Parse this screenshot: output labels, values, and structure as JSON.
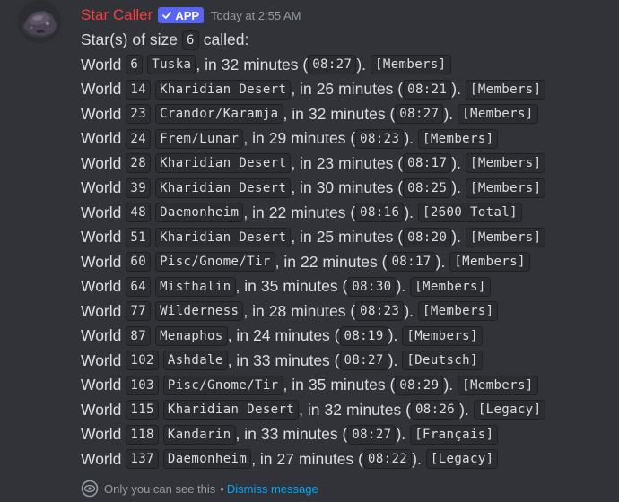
{
  "message": {
    "author": "Star Caller",
    "badge": "APP",
    "timestamp": "Today at 2:55 AM",
    "intro": {
      "prefix": "Star(s) of size",
      "size": "6",
      "suffix": "called:"
    },
    "world_label": "World",
    "in_label": ", in",
    "minutes_label": "minutes (",
    "close_label": ").",
    "rows": [
      {
        "world": "6",
        "location": "Tuska",
        "minutes": "32",
        "time": "08:27",
        "tag": "[Members]"
      },
      {
        "world": "14",
        "location": "Kharidian Desert",
        "minutes": "26",
        "time": "08:21",
        "tag": "[Members]"
      },
      {
        "world": "23",
        "location": "Crandor/Karamja",
        "minutes": "32",
        "time": "08:27",
        "tag": "[Members]"
      },
      {
        "world": "24",
        "location": "Frem/Lunar",
        "minutes": "29",
        "time": "08:23",
        "tag": "[Members]"
      },
      {
        "world": "28",
        "location": "Kharidian Desert",
        "minutes": "23",
        "time": "08:17",
        "tag": "[Members]"
      },
      {
        "world": "39",
        "location": "Kharidian Desert",
        "minutes": "30",
        "time": "08:25",
        "tag": "[Members]"
      },
      {
        "world": "48",
        "location": "Daemonheim",
        "minutes": "22",
        "time": "08:16",
        "tag": "[2600 Total]"
      },
      {
        "world": "51",
        "location": "Kharidian Desert",
        "minutes": "25",
        "time": "08:20",
        "tag": "[Members]"
      },
      {
        "world": "60",
        "location": "Pisc/Gnome/Tir",
        "minutes": "22",
        "time": "08:17",
        "tag": "[Members]"
      },
      {
        "world": "64",
        "location": "Misthalin",
        "minutes": "35",
        "time": "08:30",
        "tag": "[Members]"
      },
      {
        "world": "77",
        "location": "Wilderness",
        "minutes": "28",
        "time": "08:23",
        "tag": "[Members]"
      },
      {
        "world": "87",
        "location": "Menaphos",
        "minutes": "24",
        "time": "08:19",
        "tag": "[Members]"
      },
      {
        "world": "102",
        "location": "Ashdale",
        "minutes": "33",
        "time": "08:27",
        "tag": "[Deutsch]"
      },
      {
        "world": "103",
        "location": "Pisc/Gnome/Tir",
        "minutes": "35",
        "time": "08:29",
        "tag": "[Members]"
      },
      {
        "world": "115",
        "location": "Kharidian Desert",
        "minutes": "32",
        "time": "08:26",
        "tag": "[Legacy]"
      },
      {
        "world": "118",
        "location": "Kandarin",
        "minutes": "33",
        "time": "08:27",
        "tag": "[Français]"
      },
      {
        "world": "137",
        "location": "Daemonheim",
        "minutes": "27",
        "time": "08:22",
        "tag": "[Legacy]"
      }
    ]
  },
  "footer": {
    "notice": "Only you can see this",
    "separator": "•",
    "dismiss": "Dismiss message"
  },
  "colors": {
    "background": "#313338",
    "author": "#f23f43",
    "badge": "#5865f2",
    "link": "#00a8fc"
  },
  "icons": {
    "badge_check": "check-icon",
    "footer_eye": "eye-icon",
    "avatar": "star-rock-avatar"
  }
}
